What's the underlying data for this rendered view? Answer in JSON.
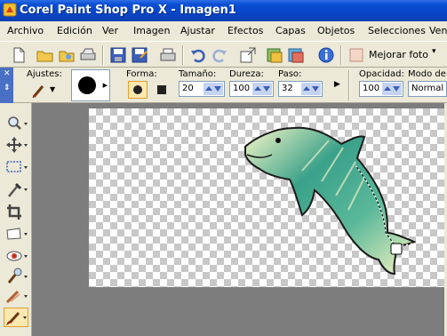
{
  "titlebar": {
    "title": "Corel Paint Shop Pro X - Imagen1"
  },
  "menu": {
    "items": [
      "Archivo",
      "Edición",
      "Ver",
      "Imagen",
      "Ajustar",
      "Efectos",
      "Capas",
      "Objetos",
      "Selecciones",
      "Ven"
    ]
  },
  "toolbar": {
    "icons": [
      "new-file-icon",
      "open-folder-icon",
      "browse-icon",
      "scan-icon",
      "save-icon",
      "save-as-icon",
      "print-icon",
      "undo-icon",
      "redo-icon",
      "resize-icon",
      "adjust-icon",
      "layers-icon",
      "info-icon",
      "enhance-icon"
    ],
    "enhance_label": "Mejorar foto"
  },
  "options": {
    "presets_label": "Ajustes:",
    "shape_label": "Forma:",
    "size_label": "Tamaño:",
    "size_value": "20",
    "hardness_label": "Dureza:",
    "hardness_value": "100",
    "step_label": "Paso:",
    "step_value": "32",
    "opacity_label": "Opacidad:",
    "opacity_value": "100",
    "blend_label": "Modo de m",
    "blend_value": "Normal"
  },
  "tools": [
    "zoom-tool-icon",
    "move-tool-icon",
    "selection-tool-icon",
    "dropper-tool-icon",
    "crop-tool-icon",
    "straighten-tool-icon",
    "red-eye-tool-icon",
    "clone-tool-icon",
    "scratch-remover-icon",
    "paintbrush-tool-icon"
  ],
  "colors": {
    "titlebar": "#0a4fd4",
    "chrome": "#ece9d8",
    "workspace": "#7d7d7d",
    "dolphin_dark": "#3aa18a",
    "dolphin_light": "#f5f5c0"
  }
}
